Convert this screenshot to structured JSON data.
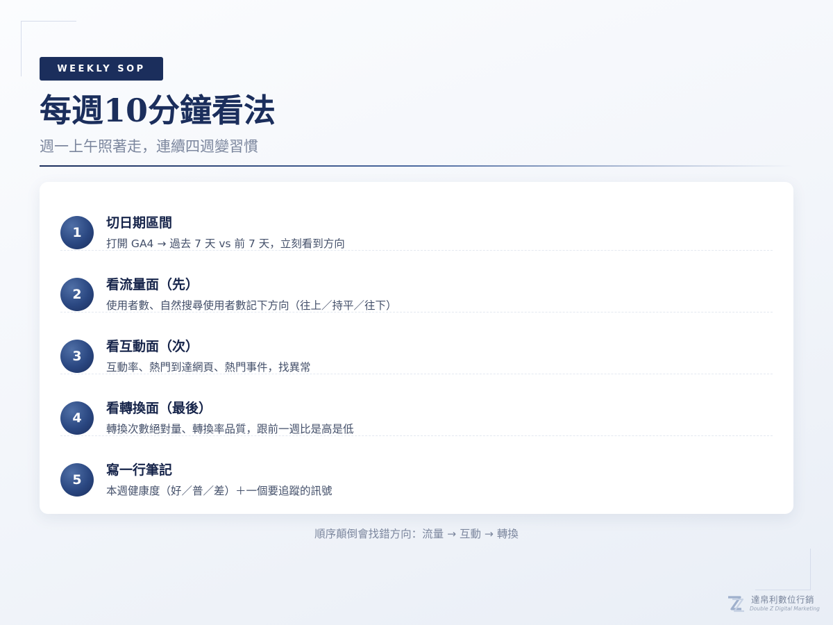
{
  "badge": "WEEKLY SOP",
  "title": "每週10分鐘看法",
  "subtitle": "週一上午照著走，連續四週變習慣",
  "steps": [
    {
      "number": "1",
      "title": "切日期區間",
      "desc": "打開 GA4 → 過去 7 天 vs 前 7 天，立刻看到方向"
    },
    {
      "number": "2",
      "title": "看流量面（先）",
      "desc": "使用者數、自然搜尋使用者數記下方向（往上／持平／往下）"
    },
    {
      "number": "3",
      "title": "看互動面（次）",
      "desc": "互動率、熱門到達網頁、熱門事件，找異常"
    },
    {
      "number": "4",
      "title": "看轉換面（最後）",
      "desc": "轉換次數絕對量、轉換率品質，跟前一週比是高是低"
    },
    {
      "number": "5",
      "title": "寫一行筆記",
      "desc": "本週健康度（好／普／差）＋一個要追蹤的訊號"
    }
  ],
  "footnote": "順序顛倒會找錯方向：流量 → 互動 → 轉換",
  "brand": {
    "name": "達帛利數位行銷",
    "sub": "Double Z Digital Marketing",
    "logo_icon": "double-z-logo"
  },
  "colors": {
    "navy": "#1b2e5c",
    "muted": "#7c879e",
    "card": "#ffffff"
  }
}
